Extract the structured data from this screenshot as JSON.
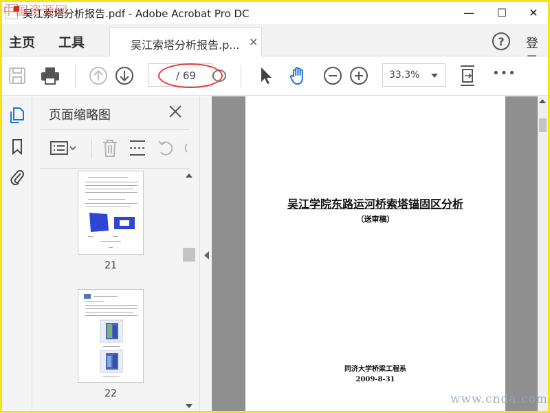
{
  "window": {
    "title": "吴江索塔分析报告.pdf - Adobe Acrobat Pro DC",
    "minimize_glyph": "—",
    "maximize_glyph": "☐",
    "close_glyph": "✕"
  },
  "menu": {
    "home_label": "主页",
    "tools_label": "工具",
    "document_tab_label": "吴江索塔分析报告.p...",
    "document_tab_close": "×",
    "help_glyph": "?",
    "login_label": "登录"
  },
  "toolbar": {
    "page_number_value": "",
    "page_total": "/ 69",
    "zoom_value": "33.3%",
    "more_glyph": "•••"
  },
  "panel": {
    "title": "页面缩略图",
    "thumbnails": [
      {
        "label": "21"
      },
      {
        "label": "22"
      }
    ]
  },
  "document": {
    "title": "吴江学院东路运河桥索塔锚固区分析",
    "subtitle": "（送审稿）",
    "organization": "同济大学桥梁工程系",
    "date": "2009-8-31"
  },
  "watermarks": {
    "top_left": "中国资源网",
    "bottom_right": "www.cnda.com"
  },
  "colors": {
    "accent_blue": "#1976d2",
    "annotation_red": "#e53935",
    "screenshot_border": "#f4e21a"
  },
  "icons": {
    "save": "save-icon",
    "print": "print-icon",
    "prev_page": "arrow-up-circle-icon",
    "next_page": "arrow-down-circle-icon",
    "select": "cursor-arrow-icon",
    "hand": "hand-icon",
    "zoom_out": "zoom-out-icon",
    "zoom_in": "zoom-in-icon",
    "fit": "fit-page-icon",
    "more": "more-icon"
  }
}
